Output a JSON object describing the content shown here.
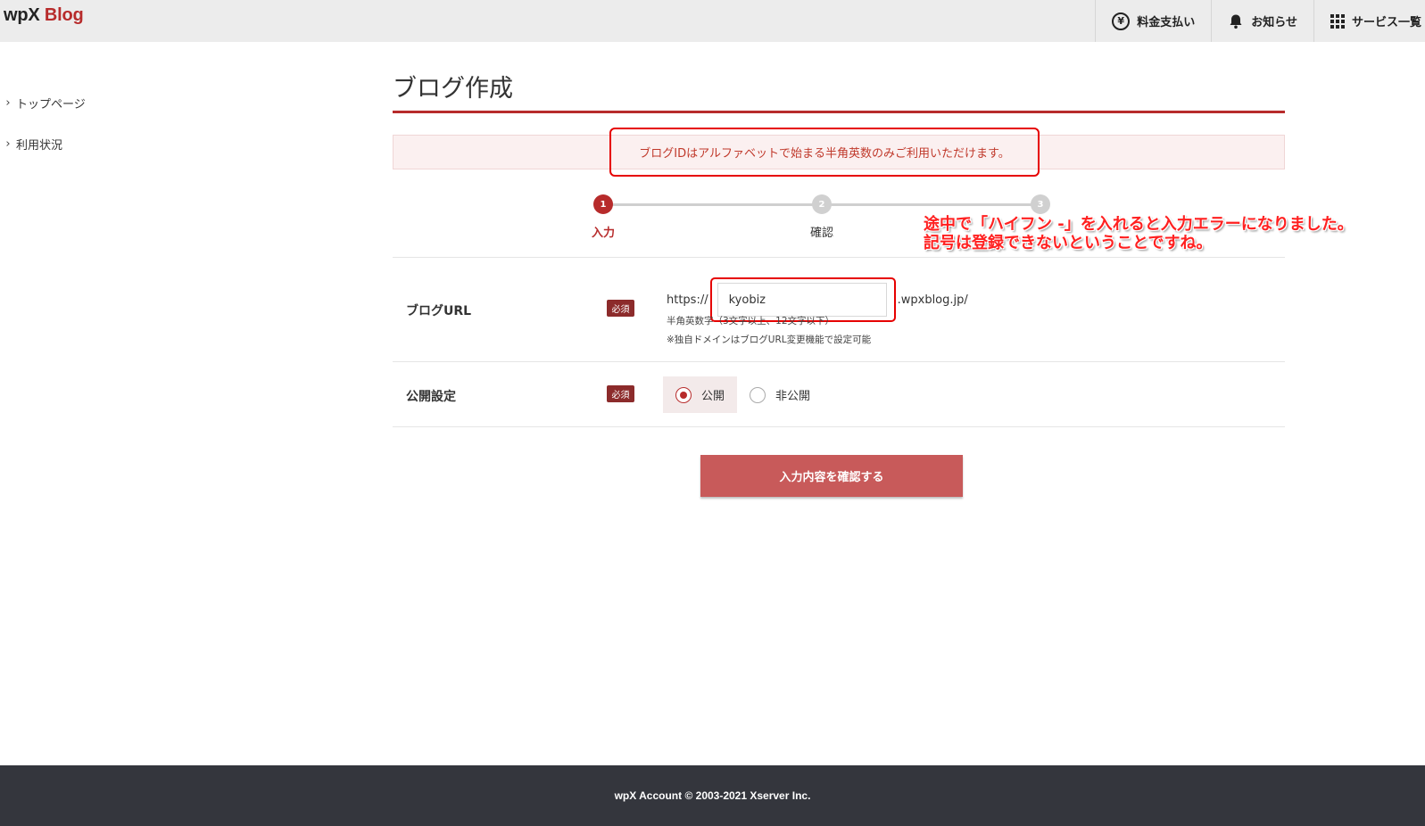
{
  "header": {
    "logo_wpx": "wpX",
    "logo_blog": "Blog",
    "nav": [
      {
        "label": "料金支払い",
        "icon": "yen-icon"
      },
      {
        "label": "お知らせ",
        "icon": "bell-icon"
      },
      {
        "label": "サービス一覧",
        "icon": "grid-icon"
      }
    ]
  },
  "sidebar": {
    "items": [
      {
        "label": "トップページ"
      },
      {
        "label": "利用状況"
      }
    ]
  },
  "main": {
    "title": "ブログ作成",
    "alert": "ブログIDはアルファベットで始まる半角英数のみご利用いただけます。",
    "steps": [
      {
        "num": "1",
        "label": "入力",
        "active": true
      },
      {
        "num": "2",
        "label": "確認",
        "active": false
      },
      {
        "num": "3",
        "label": "",
        "active": false
      }
    ],
    "annotation": {
      "line1": "途中で「ハイフン -」を入れると入力エラーになりました。",
      "line2": "記号は登録できないということですね。"
    },
    "form": {
      "url_label": "ブログURL",
      "required": "必須",
      "url_prefix": "https://",
      "url_value": "kyobiz",
      "url_suffix": ".wpxblog.jp/",
      "hint1": "半角英数字（3文字以上、12文字以下）",
      "hint2": "※独自ドメインはブログURL変更機能で設定可能",
      "publish_label": "公開設定",
      "option_public": "公開",
      "option_private": "非公開"
    },
    "submit_label": "入力内容を確認する"
  },
  "footer": {
    "copyright": "wpX Account © 2003-2021 Xserver Inc."
  },
  "colors": {
    "accent": "#b72b2b",
    "button": "#c85a5a",
    "footer_bg": "#34363d",
    "highlight": "#e60000"
  }
}
